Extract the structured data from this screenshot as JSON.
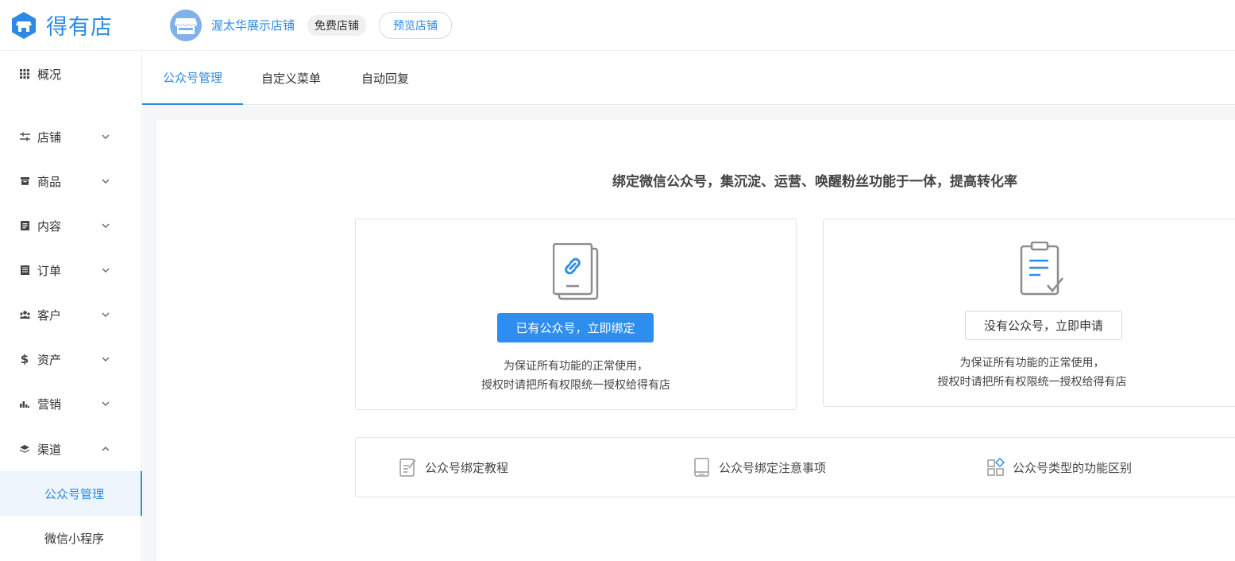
{
  "header": {
    "brand_name": "得有店",
    "shop_name": "渥太华展示店铺",
    "badge": "免费店铺",
    "preview_label": "预览店铺"
  },
  "sidebar": {
    "overview": "概况",
    "items": [
      {
        "label": "店铺",
        "icon": "sliders-icon"
      },
      {
        "label": "商品",
        "icon": "box-icon"
      },
      {
        "label": "内容",
        "icon": "document-icon"
      },
      {
        "label": "订单",
        "icon": "order-icon"
      },
      {
        "label": "客户",
        "icon": "users-icon"
      },
      {
        "label": "资产",
        "icon": "dollar-icon"
      },
      {
        "label": "营销",
        "icon": "bar-chart-icon"
      },
      {
        "label": "渠道",
        "icon": "layers-icon"
      }
    ],
    "sub_items": [
      {
        "label": "公众号管理",
        "active": true
      },
      {
        "label": "微信小程序",
        "active": false
      }
    ]
  },
  "tabs": [
    {
      "label": "公众号管理",
      "active": true
    },
    {
      "label": "自定义菜单",
      "active": false
    },
    {
      "label": "自动回复",
      "active": false
    }
  ],
  "main": {
    "headline": "绑定微信公众号，集沉淀、运营、唤醒粉丝功能于一体，提高转化率",
    "bind_card": {
      "button": "已有公众号，立即绑定",
      "note_line1": "为保证所有功能的正常使用，",
      "note_line2": "授权时请把所有权限统一授权给得有店"
    },
    "apply_card": {
      "button": "没有公众号，立即申请",
      "note_line1": "为保证所有功能的正常使用，",
      "note_line2": "授权时请把所有权限统一授权给得有店"
    },
    "links": [
      {
        "label": "公众号绑定教程",
        "icon": "edit-doc-icon"
      },
      {
        "label": "公众号绑定注意事项",
        "icon": "book-icon"
      },
      {
        "label": "公众号类型的功能区别",
        "icon": "grid-icon"
      }
    ]
  },
  "colors": {
    "accent": "#2b8ae8",
    "primary_button": "#2e8ef0"
  }
}
